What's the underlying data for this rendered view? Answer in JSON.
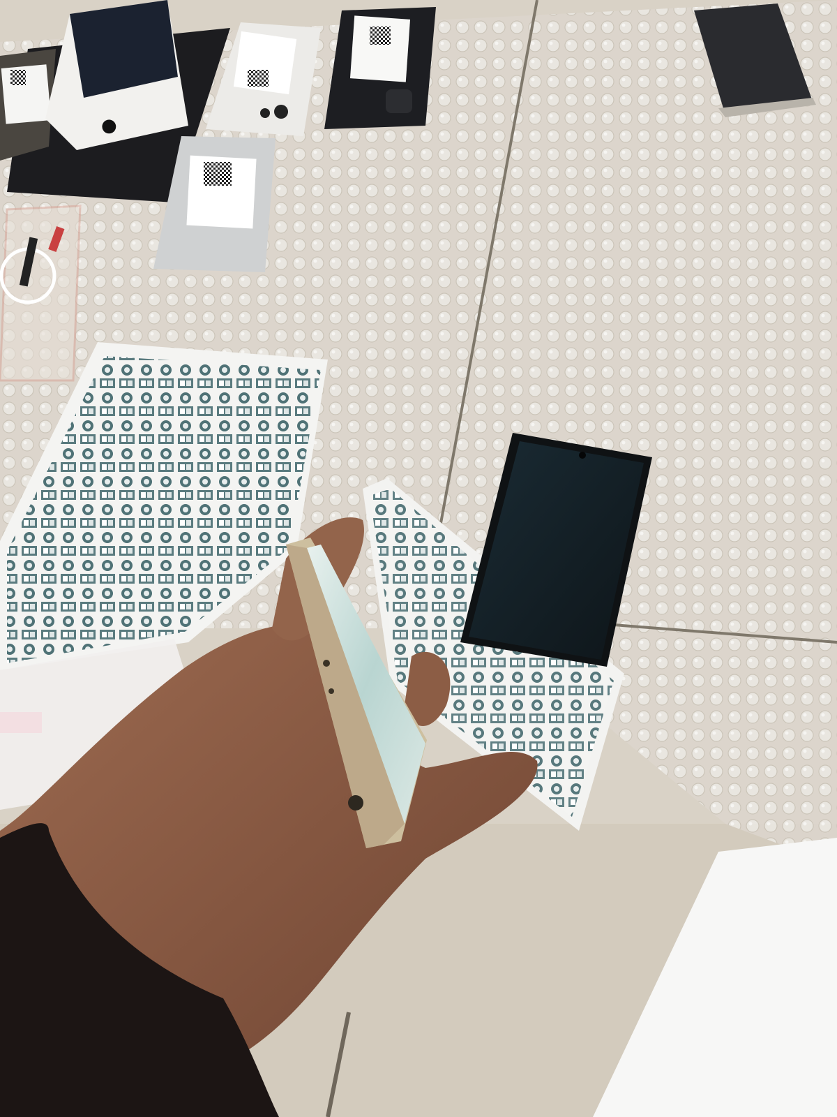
{
  "scene": {
    "description_visible_text": []
  },
  "colors": {
    "floor": "#d9d2c6",
    "floor_dark": "#bfb6a8",
    "bubble_wrap": "#e9e6e1",
    "sheet_paper": "#f4f4f2",
    "sticker_teal": "#4f7276",
    "phone_black": "#1d1e22",
    "phone_white": "#ecebe8",
    "phone_silver": "#cfd1d2",
    "gold_frame": "#cdbf9f",
    "skin": "#8a5a42",
    "sleeve": "#1c1514",
    "box_white": "#f2f1ee",
    "grout": "#8d8577"
  },
  "icons": [
    "apple-logo-icon",
    "qr-code-icon"
  ]
}
